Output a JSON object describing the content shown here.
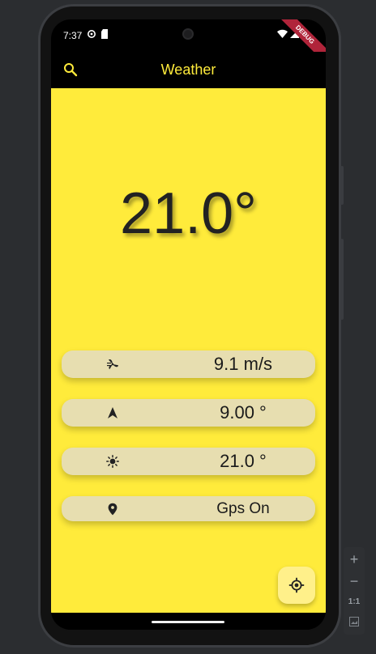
{
  "status": {
    "time": "7:37",
    "debug_banner": "DEBUG"
  },
  "appbar": {
    "title": "Weather",
    "search_icon": "search-icon"
  },
  "main": {
    "temperature": "21.0°",
    "cards": [
      {
        "icon": "wind-icon",
        "value": "9.1 m/s"
      },
      {
        "icon": "navigation-arrow-icon",
        "value": "9.00 °"
      },
      {
        "icon": "sun-icon",
        "value": "21.0 °"
      },
      {
        "icon": "location-pin-icon",
        "value": "Gps On"
      }
    ]
  },
  "fab": {
    "icon": "my-location-icon"
  },
  "emulator_controls": {
    "zoom_in": "+",
    "zoom_out": "−",
    "actual_size": "1:1"
  },
  "colors": {
    "accent": "#ffeb3b",
    "card": "#e7deb0",
    "fab": "#fff08a",
    "app_bar": "#000000"
  }
}
